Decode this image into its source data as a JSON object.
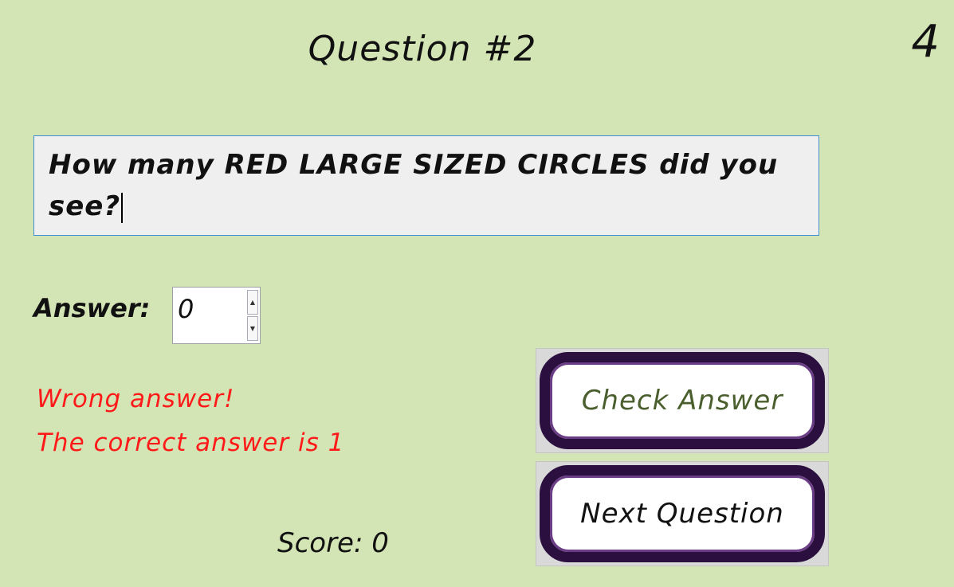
{
  "header": {
    "title": "Question #2",
    "counter": "4"
  },
  "question": {
    "text": "How many RED LARGE SIZED CIRCLES did you see?"
  },
  "answer": {
    "label": "Answer:",
    "value": "0",
    "up_glyph": "▲",
    "down_glyph": "▼"
  },
  "feedback": {
    "line1": "Wrong answer!",
    "line2": "The correct answer is 1",
    "color": "#ff1a1a"
  },
  "score": {
    "text": "Score: 0"
  },
  "buttons": {
    "check_label": "Check Answer",
    "next_label": "Next Question"
  },
  "colors": {
    "background": "#d4e5b5",
    "button_border": "#2b0f3f",
    "check_text": "#4a5f2d"
  }
}
